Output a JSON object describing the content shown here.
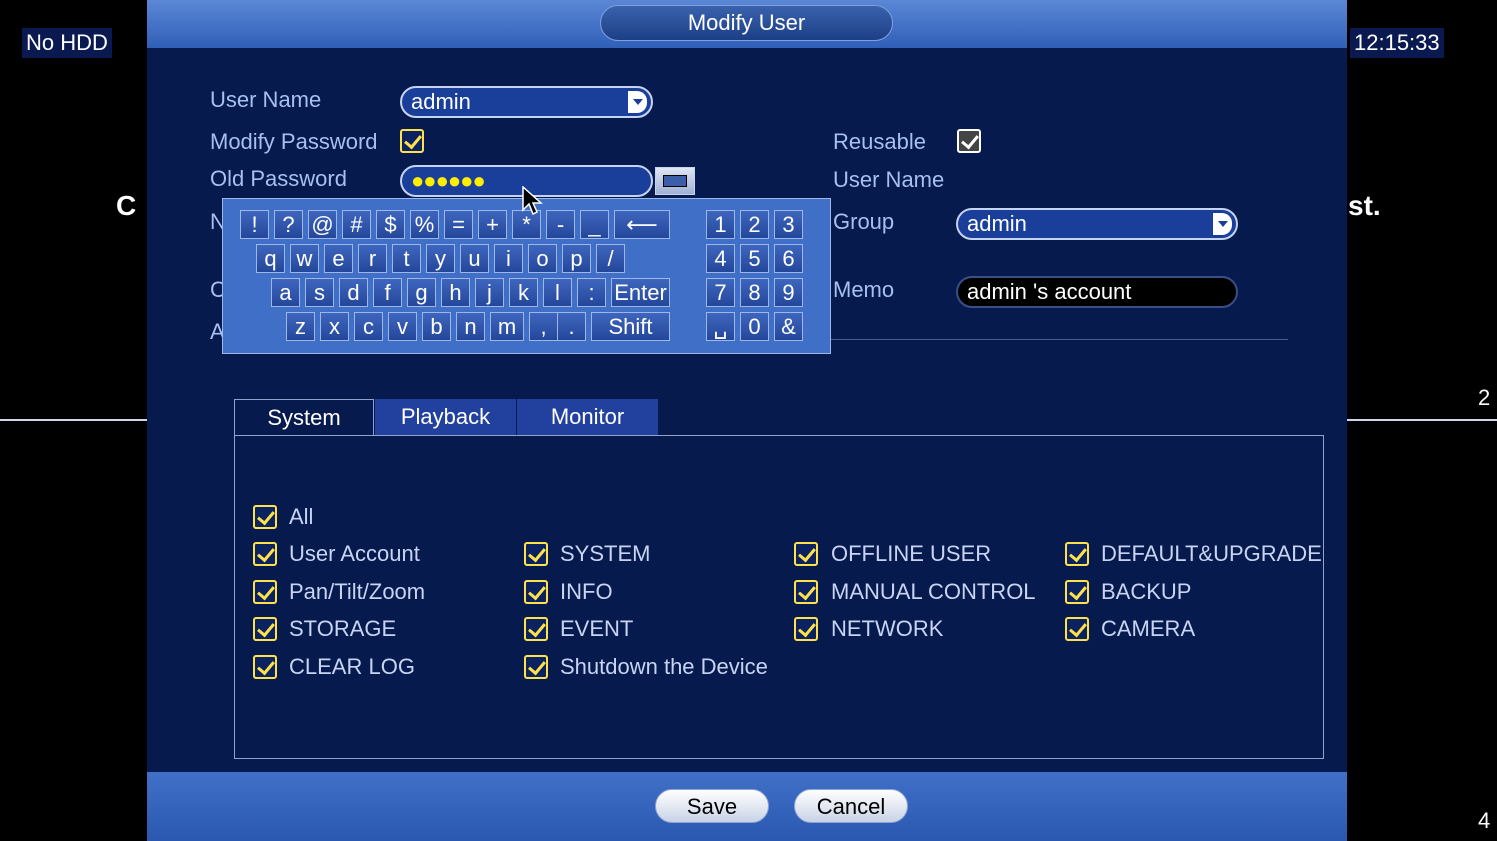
{
  "background": {
    "status_left": "No HDD",
    "clock": "12:15:33",
    "channel_a": "2",
    "channel_b": "4",
    "text_left_fragment": "C",
    "text_right_fragment": "st."
  },
  "dialog": {
    "title": "Modify User",
    "save_label": "Save",
    "cancel_label": "Cancel"
  },
  "form": {
    "user_name_label": "User Name",
    "user_name_value": "admin",
    "modify_password_label": "Modify Password",
    "modify_password_checked": true,
    "old_password_label": "Old Password",
    "old_password_masked": "●●●●●●",
    "reusable_label": "Reusable",
    "reusable_checked": true,
    "user_name_right_label": "User Name",
    "group_label": "Group",
    "group_value": "admin",
    "memo_label": "Memo",
    "memo_value": "admin 's account",
    "hidden_label_n": "N",
    "hidden_label_c": "C",
    "hidden_label_a": "A"
  },
  "keyboard": {
    "row1": [
      "!",
      "?",
      "@",
      "#",
      "$",
      "%",
      "=",
      "+",
      "*",
      "-",
      "_",
      "⟵"
    ],
    "row2": [
      "q",
      "w",
      "e",
      "r",
      "t",
      "y",
      "u",
      "i",
      "o",
      "p",
      "/"
    ],
    "row3": [
      "a",
      "s",
      "d",
      "f",
      "g",
      "h",
      "j",
      "k",
      "l",
      ":",
      "Enter"
    ],
    "row4": [
      "z",
      "x",
      "c",
      "v",
      "b",
      "n",
      "m",
      ",",
      ".",
      "Shift"
    ],
    "num1": [
      "1",
      "2",
      "3"
    ],
    "num2": [
      "4",
      "5",
      "6"
    ],
    "num3": [
      "7",
      "8",
      "9"
    ],
    "num4": [
      "␣",
      "0",
      "&"
    ]
  },
  "tabs": [
    {
      "label": "System",
      "active": true
    },
    {
      "label": "Playback",
      "active": false
    },
    {
      "label": "Monitor",
      "active": false
    }
  ],
  "permissions": {
    "all": "All",
    "col1": [
      "User Account",
      "Pan/Tilt/Zoom",
      "STORAGE",
      "CLEAR LOG"
    ],
    "col2": [
      "SYSTEM",
      "INFO",
      "EVENT",
      "Shutdown the Device"
    ],
    "col3": [
      "OFFLINE USER",
      "MANUAL CONTROL",
      "NETWORK"
    ],
    "col4": [
      "DEFAULT&UPGRADE",
      "BACKUP",
      "CAMERA"
    ]
  },
  "colors": {
    "dialog_bg": "#061a4e",
    "label": "#a8bff0",
    "check_yellow": "#ffe14d"
  }
}
